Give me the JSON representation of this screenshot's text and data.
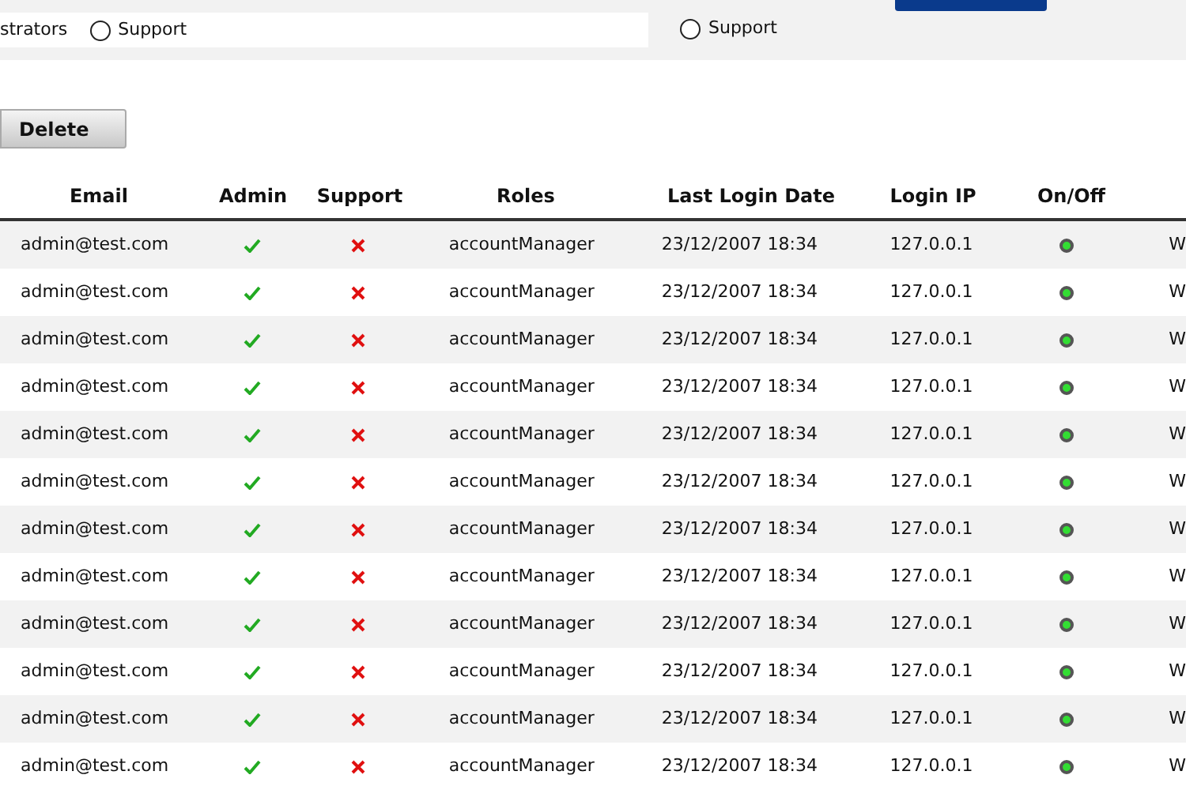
{
  "filter_bar": {
    "left_text": "strators",
    "left_radio": {
      "label": "Support",
      "selected": false
    },
    "right_radio": {
      "label": "Support",
      "selected": false
    }
  },
  "toolbar": {
    "delete_button": "Delete"
  },
  "table": {
    "columns": [
      "Email",
      "Admin",
      "Support",
      "Roles",
      "Last Login Date",
      "Login IP",
      "On/Off"
    ],
    "rows": [
      {
        "email": "admin@test.com",
        "admin": true,
        "support": false,
        "roles": "accountManager",
        "last_login": "23/12/2007 18:34",
        "ip": "127.0.0.1",
        "on": true,
        "column_8": "W"
      },
      {
        "email": "admin@test.com",
        "admin": true,
        "support": false,
        "roles": "accountManager",
        "last_login": "23/12/2007 18:34",
        "ip": "127.0.0.1",
        "on": true,
        "column_8": "W"
      },
      {
        "email": "admin@test.com",
        "admin": true,
        "support": false,
        "roles": "accountManager",
        "last_login": "23/12/2007 18:34",
        "ip": "127.0.0.1",
        "on": true,
        "column_8": "W"
      },
      {
        "email": "admin@test.com",
        "admin": true,
        "support": false,
        "roles": "accountManager",
        "last_login": "23/12/2007 18:34",
        "ip": "127.0.0.1",
        "on": true,
        "column_8": "W"
      },
      {
        "email": "admin@test.com",
        "admin": true,
        "support": false,
        "roles": "accountManager",
        "last_login": "23/12/2007 18:34",
        "ip": "127.0.0.1",
        "on": true,
        "column_8": "W"
      },
      {
        "email": "admin@test.com",
        "admin": true,
        "support": false,
        "roles": "accountManager",
        "last_login": "23/12/2007 18:34",
        "ip": "127.0.0.1",
        "on": true,
        "column_8": "W"
      },
      {
        "email": "admin@test.com",
        "admin": true,
        "support": false,
        "roles": "accountManager",
        "last_login": "23/12/2007 18:34",
        "ip": "127.0.0.1",
        "on": true,
        "column_8": "W"
      },
      {
        "email": "admin@test.com",
        "admin": true,
        "support": false,
        "roles": "accountManager",
        "last_login": "23/12/2007 18:34",
        "ip": "127.0.0.1",
        "on": true,
        "column_8": "W"
      },
      {
        "email": "admin@test.com",
        "admin": true,
        "support": false,
        "roles": "accountManager",
        "last_login": "23/12/2007 18:34",
        "ip": "127.0.0.1",
        "on": true,
        "column_8": "W"
      },
      {
        "email": "admin@test.com",
        "admin": true,
        "support": false,
        "roles": "accountManager",
        "last_login": "23/12/2007 18:34",
        "ip": "127.0.0.1",
        "on": true,
        "column_8": "W"
      },
      {
        "email": "admin@test.com",
        "admin": true,
        "support": false,
        "roles": "accountManager",
        "last_login": "23/12/2007 18:34",
        "ip": "127.0.0.1",
        "on": true,
        "column_8": "W"
      },
      {
        "email": "admin@test.com",
        "admin": true,
        "support": false,
        "roles": "accountManager",
        "last_login": "23/12/2007 18:34",
        "ip": "127.0.0.1",
        "on": true,
        "column_8": "W"
      }
    ]
  }
}
